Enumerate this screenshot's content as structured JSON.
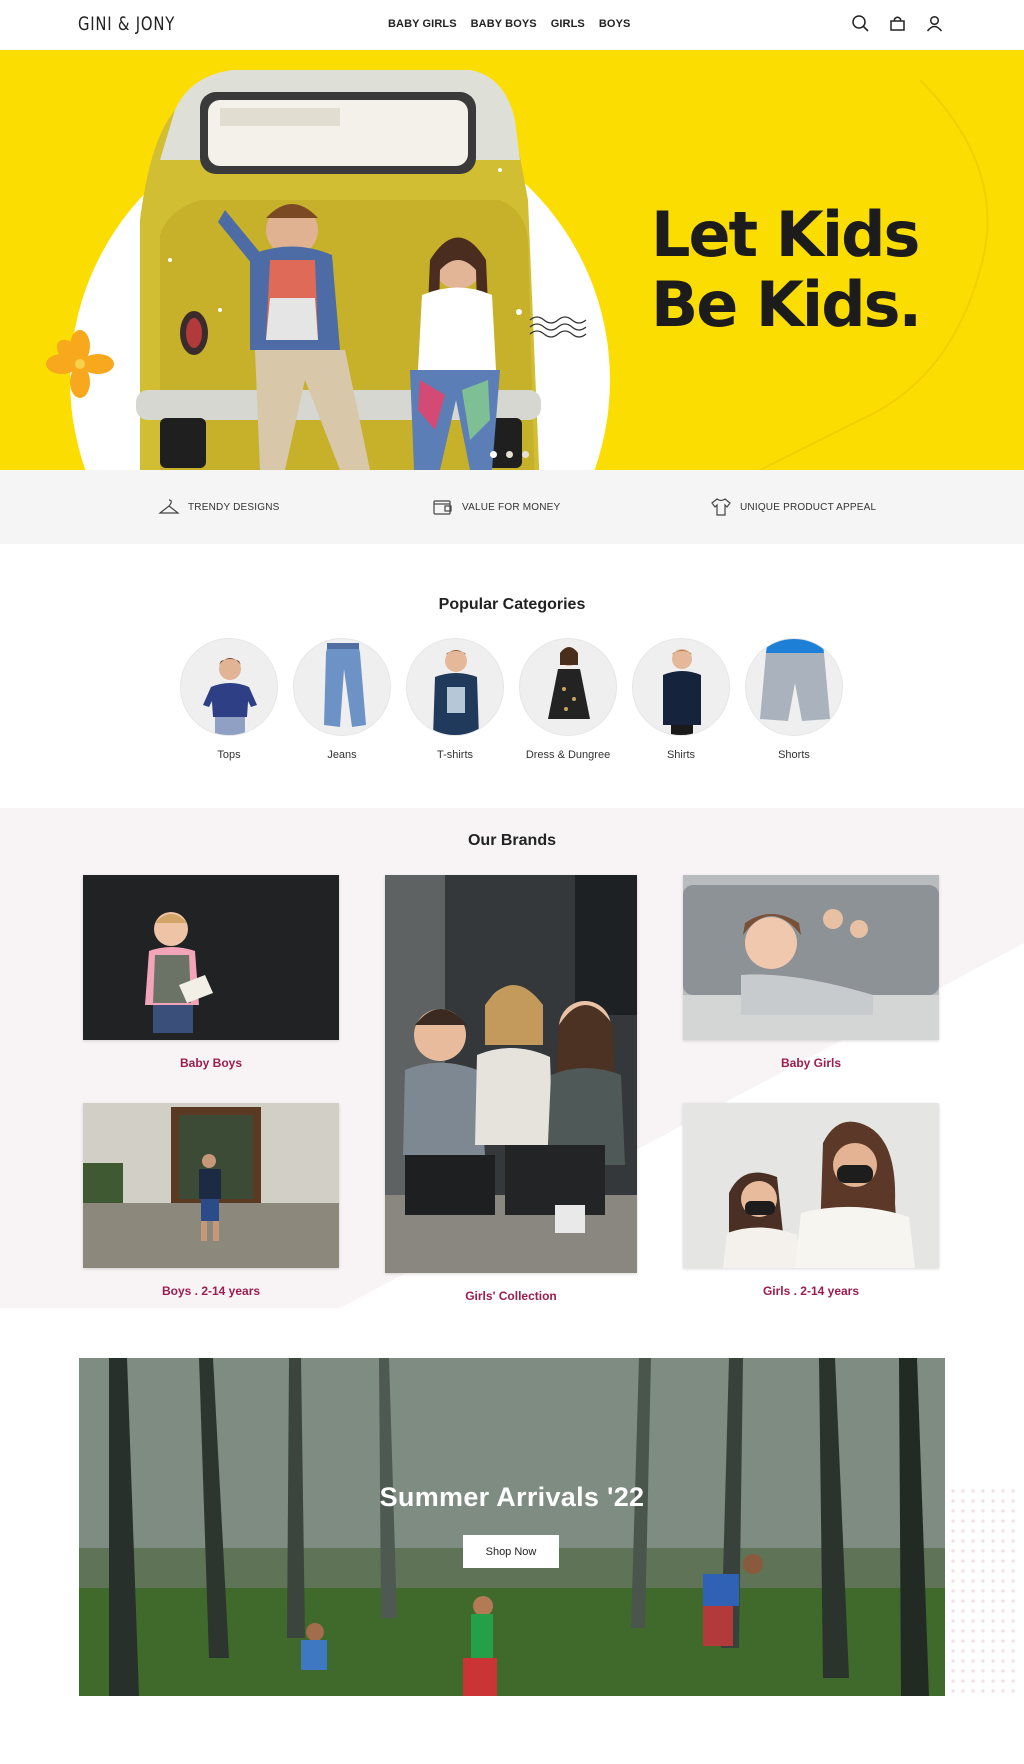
{
  "header": {
    "logo": "GINI & JONY",
    "nav": [
      "BABY GIRLS",
      "BABY BOYS",
      "GIRLS",
      "BOYS"
    ],
    "icons": [
      "search-icon",
      "bag-icon",
      "user-icon"
    ]
  },
  "hero": {
    "title_line1": "Let Kids",
    "title_line2": "Be Kids.",
    "slides": 3,
    "active_slide": 1,
    "background_color": "#fcdd02"
  },
  "features": [
    {
      "icon": "hanger-icon",
      "label": "TRENDY DESIGNS"
    },
    {
      "icon": "wallet-icon",
      "label": "VALUE FOR MONEY"
    },
    {
      "icon": "tshirt-icon",
      "label": "UNIQUE PRODUCT APPEAL"
    }
  ],
  "categories": {
    "title": "Popular Categories",
    "items": [
      "Tops",
      "Jeans",
      "T-shirts",
      "Dress & Dungree",
      "Shirts",
      "Shorts"
    ]
  },
  "brands": {
    "title": "Our Brands",
    "items": [
      "Baby Boys",
      "Girls' Collection",
      "Baby Girls",
      "Boys . 2-14 years",
      "Girls . 2-14 years"
    ],
    "label_color": "#9b1d4f"
  },
  "summer": {
    "title": "Summer Arrivals '22",
    "button": "Shop Now"
  }
}
